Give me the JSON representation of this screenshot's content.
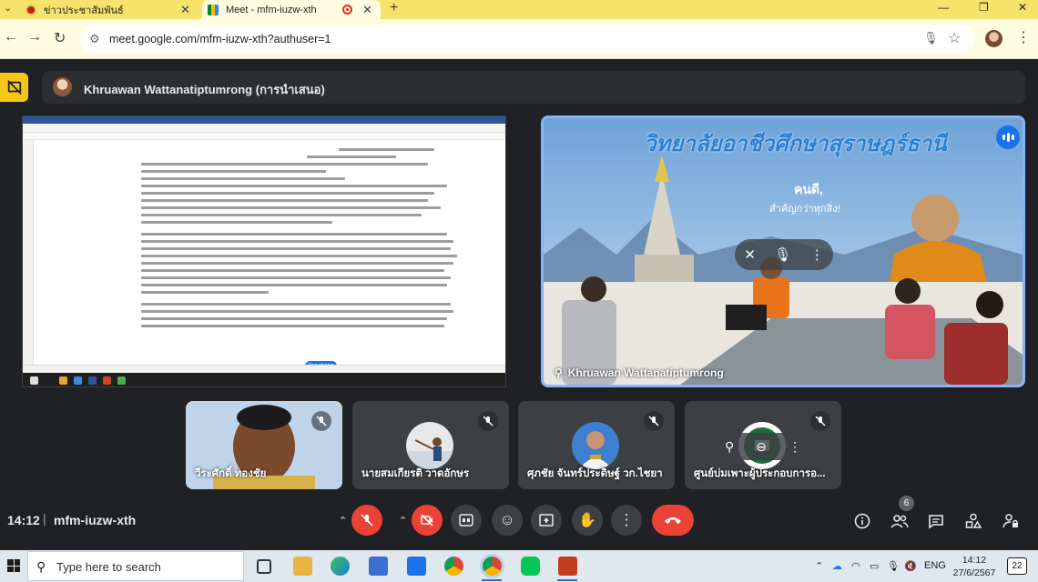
{
  "browser": {
    "tabs": [
      {
        "title": "ข่าวประชาสัมพันธ์",
        "close": "✕"
      },
      {
        "title": "Meet - mfm-iuzw-xth",
        "close": "✕"
      }
    ],
    "new_tab": "+",
    "url": "meet.google.com/mfm-iuzw-xth?authuser=1",
    "window_controls": {
      "minimize": "—",
      "restore": "❐",
      "close": "✕"
    }
  },
  "meet": {
    "presenter_label": "Khruawan Wattanatiptumrong (การนำเสนอ)",
    "stop_sharing_label": "Stop sharing",
    "main_tile": {
      "participant_name": "Khruawan Wattanatiptumrong",
      "banner_text": "วิทยาลัยอาชีวศึกษาสุราษฎร์ธานี",
      "slogan_1": "คนดี,",
      "slogan_2": "สำคัญกว่าทุกสิ่ง!"
    },
    "participants": [
      {
        "name": "วีระศักดิ์ ทองชัย",
        "muted": true
      },
      {
        "name": "นายสมเกียรติ วาดอักษร",
        "muted": true
      },
      {
        "name": "ศุภชัย จันทร์ประดิษฐ์ วก.ไชยา",
        "muted": true
      },
      {
        "name": "ศูนย์บ่มเพาะผู้ประกอบการอ...",
        "muted": true
      }
    ],
    "bottom_bar": {
      "time": "14:12",
      "separator": "|",
      "meeting_code": "mfm-iuzw-xth",
      "people_count": "6"
    },
    "colors": {
      "background": "#202124",
      "leave_button": "#ea4335",
      "active_speaker": "#8ab4f8",
      "accent": "#1a73e8"
    }
  },
  "taskbar": {
    "search_placeholder": "Type here to search",
    "tray_language": "ENG",
    "clock_time": "14:12",
    "clock_date": "27/6/2567",
    "notification_count": "22"
  }
}
